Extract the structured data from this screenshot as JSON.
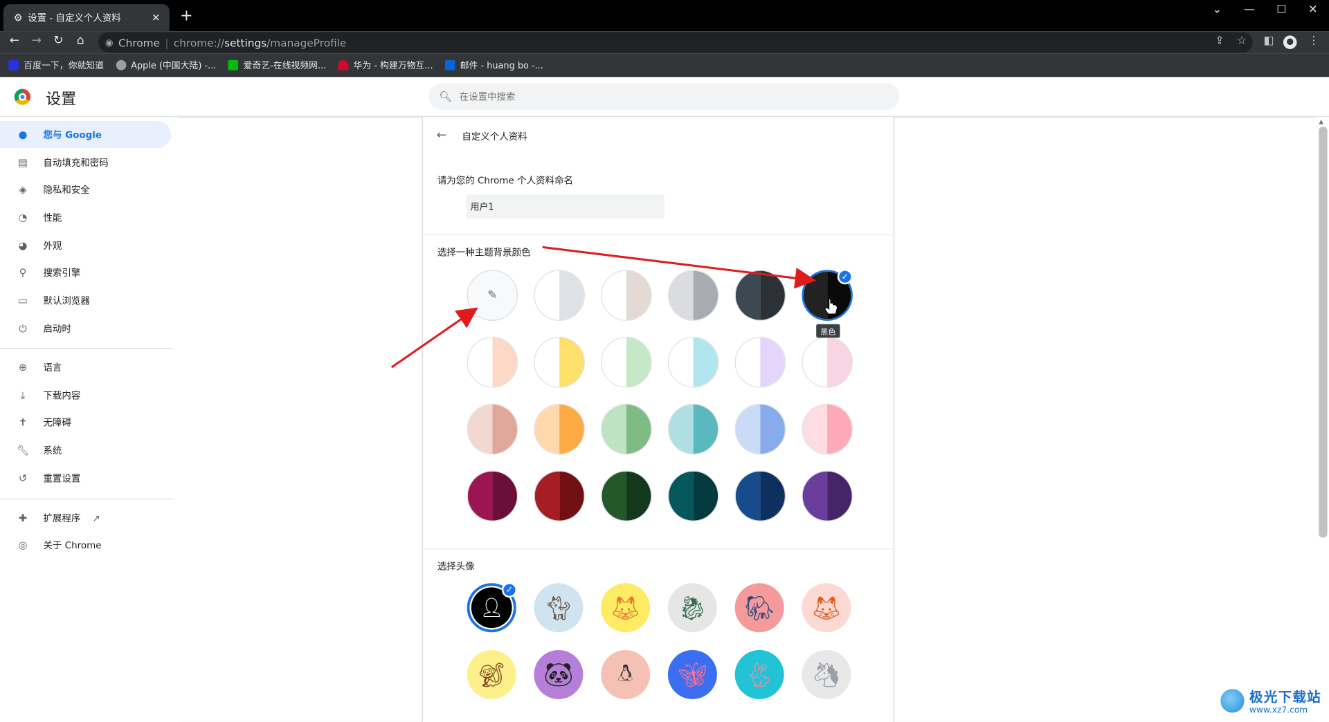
{
  "browser": {
    "tab_title": "设置 - 自定义个人资料",
    "tab_icon": "gear-icon",
    "omnibox": {
      "site_label": "Chrome",
      "scheme": "chrome://",
      "host": "settings",
      "path": "/manageProfile"
    },
    "bookmarks": [
      {
        "label": "百度一下，你就知道",
        "color": "#2932e1"
      },
      {
        "label": "Apple (中国大陆) -...",
        "color": "#9e9e9e"
      },
      {
        "label": "爱奇艺-在线视频网...",
        "color": "#00be06"
      },
      {
        "label": "华为 - 构建万物互...",
        "color": "#cf0a2c"
      },
      {
        "label": "邮件 - huang bo -...",
        "color": "#0a64d8"
      }
    ]
  },
  "settings": {
    "title": "设置",
    "search_placeholder": "在设置中搜索",
    "sidebar": [
      {
        "label": "您与 Google",
        "icon": "person-icon",
        "active": true
      },
      {
        "label": "自动填充和密码",
        "icon": "clipboard-icon"
      },
      {
        "label": "隐私和安全",
        "icon": "shield-icon"
      },
      {
        "label": "性能",
        "icon": "speedometer-icon"
      },
      {
        "label": "外观",
        "icon": "palette-icon"
      },
      {
        "label": "搜索引擎",
        "icon": "search-icon"
      },
      {
        "label": "默认浏览器",
        "icon": "browser-icon"
      },
      {
        "label": "启动时",
        "icon": "power-icon"
      },
      {
        "label": "语言",
        "icon": "globe-icon"
      },
      {
        "label": "下载内容",
        "icon": "download-icon"
      },
      {
        "label": "无障碍",
        "icon": "accessibility-icon"
      },
      {
        "label": "系统",
        "icon": "wrench-icon"
      },
      {
        "label": "重置设置",
        "icon": "history-icon"
      },
      {
        "label": "扩展程序",
        "icon": "puzzle-icon"
      },
      {
        "label": "关于 Chrome",
        "icon": "chrome-icon"
      }
    ],
    "page": {
      "title": "自定义个人资料",
      "name_label": "请为您的 Chrome 个人资料命名",
      "name_value": "用户1",
      "color_label": "选择一种主题背景颜色",
      "selected_tooltip": "黑色",
      "avatar_label": "选择头像",
      "colors": [
        [
          [
            "#f8f9fa",
            "#f8f9fa"
          ],
          [
            "#ffffff",
            "#dee1e6"
          ],
          [
            "#ffffff",
            "#e3dad6"
          ],
          [
            "#dadce0",
            "#a8abb2"
          ],
          [
            "#3c4852",
            "#2a3238"
          ],
          [
            "#222222",
            "#0a0a0a"
          ]
        ],
        [
          [
            "#ffffff",
            "#fcd9c6"
          ],
          [
            "#ffffff",
            "#fde06a"
          ],
          [
            "#ffffff",
            "#c6e8c6"
          ],
          [
            "#ffffff",
            "#b2e6ef"
          ],
          [
            "#ffffff",
            "#e5d5fc"
          ],
          [
            "#ffffff",
            "#f9d4e2"
          ]
        ],
        [
          [
            "#f3d8d1",
            "#e0a899"
          ],
          [
            "#ffd8ac",
            "#fbaa44"
          ],
          [
            "#bde3c2",
            "#7dbc84"
          ],
          [
            "#b0dfe3",
            "#5ab8bf"
          ],
          [
            "#c9dbf6",
            "#86acec"
          ],
          [
            "#fddce2",
            "#fcaab8"
          ]
        ],
        [
          [
            "#9c1553",
            "#6b0f38"
          ],
          [
            "#a51d25",
            "#700f14"
          ],
          [
            "#23582a",
            "#14381a"
          ],
          [
            "#04575b",
            "#033a3d"
          ],
          [
            "#164b8c",
            "#0d305e"
          ],
          [
            "#6b3e9e",
            "#452468"
          ]
        ]
      ],
      "avatars": [
        {
          "name": "generic-avatar",
          "bg": "#000000",
          "selected": true
        },
        {
          "name": "cat-avatar",
          "bg": "#cfe4f0"
        },
        {
          "name": "fox-avatar",
          "bg": "#fdeb63"
        },
        {
          "name": "dragon-avatar",
          "bg": "#e6e6e6"
        },
        {
          "name": "elephant-avatar",
          "bg": "#f59a9a"
        },
        {
          "name": "fox-orange-avatar",
          "bg": "#fcdad3"
        },
        {
          "name": "monkey-avatar",
          "bg": "#fdf08b"
        },
        {
          "name": "panda-avatar",
          "bg": "#b57fd9"
        },
        {
          "name": "penguin-avatar",
          "bg": "#f5c1b4"
        },
        {
          "name": "butterfly-avatar",
          "bg": "#3b6ef0"
        },
        {
          "name": "rabbit-avatar",
          "bg": "#23c3d6"
        },
        {
          "name": "unicorn-avatar",
          "bg": "#e8e8e8"
        }
      ]
    }
  },
  "watermark": {
    "title": "极光下载站",
    "url": "www.xz7.com"
  }
}
